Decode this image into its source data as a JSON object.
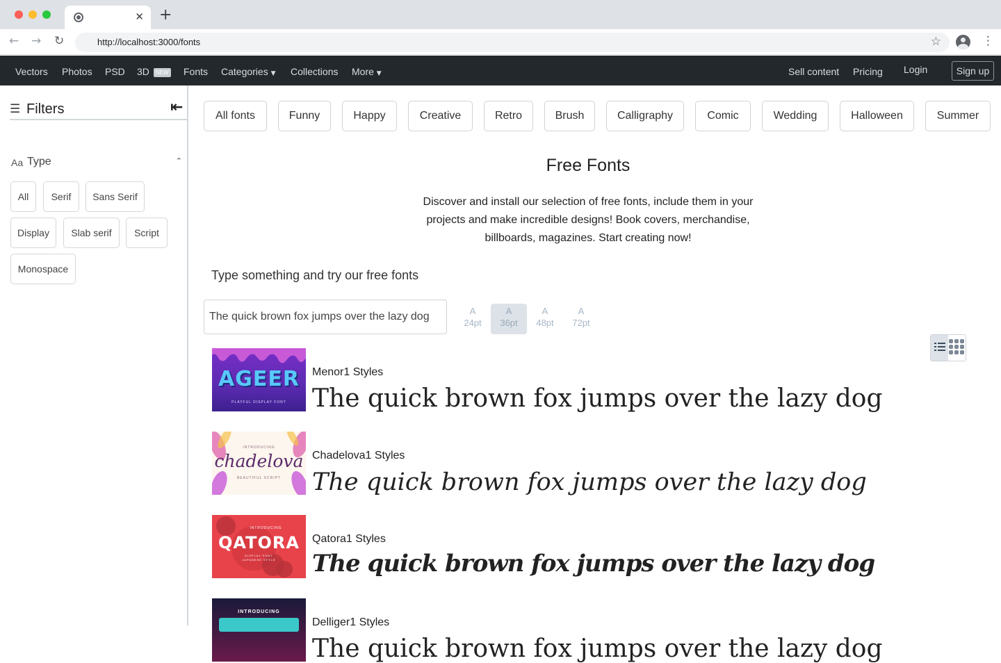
{
  "browser": {
    "url": "http://localhost:3000/fonts",
    "icons": {
      "back": "back-arrow-icon",
      "forward": "forward-arrow-icon",
      "reload": "reload-icon",
      "bookmark": "star-icon",
      "profile": "profile-icon",
      "menu": "kebab-menu-icon",
      "new_tab": "plus-icon",
      "close_tab": "close-icon"
    }
  },
  "nav": {
    "left": [
      "Vectors",
      "Photos",
      "PSD",
      "3D",
      "Fonts",
      "Categories",
      "Collections",
      "More"
    ],
    "new_badge": "NEW",
    "right": [
      "Sell content",
      "Pricing",
      "Login"
    ],
    "signup": "Sign up"
  },
  "sidebar": {
    "filters_title": "Filters",
    "type_icon_text": "Aa",
    "type_label": "Type",
    "type_options": [
      "All",
      "Serif",
      "Sans Serif",
      "Display",
      "Slab serif",
      "Script",
      "Monospace"
    ]
  },
  "categories": [
    "All fonts",
    "Funny",
    "Happy",
    "Creative",
    "Retro",
    "Brush",
    "Calligraphy",
    "Comic",
    "Wedding",
    "Halloween",
    "Summer"
  ],
  "main": {
    "title": "Free Fonts",
    "description": "Discover and install our selection of free fonts, include them in your projects and make incredible designs! Book covers, merchandise, billboards, magazines. Start creating now!",
    "try_label": "Type something and try our free fonts",
    "sample_value": "The quick brown fox jumps over the lazy dog",
    "size_letter": "A",
    "sizes": [
      "24pt",
      "36pt",
      "48pt",
      "72pt"
    ],
    "active_size": "36pt"
  },
  "fonts": [
    {
      "name": "Menor1 Styles",
      "sample": "The quick brown fox jumps over the lazy dog",
      "thumb_text": "AGEER",
      "thumb_sub": "PLAYFUL DISPLAY FONT"
    },
    {
      "name": "Chadelova1 Styles",
      "sample": "The quick brown fox jumps over the lazy dog",
      "thumb_text": "chadelova",
      "thumb_top": "INTRODUCING",
      "thumb_sub": "BEAUTIFUL SCRIPT"
    },
    {
      "name": "Qatora1 Styles",
      "sample": "The quick brown fox jumps over the lazy dog",
      "thumb_text": "QATORA",
      "thumb_top": "INTRODUCING",
      "thumb_sub": "DISPLAY FONT JAPANESE STYLE"
    },
    {
      "name": "Delliger1 Styles",
      "sample": "The quick brown fox jumps over the lazy dog",
      "thumb_top": "INTRODUCING"
    }
  ]
}
